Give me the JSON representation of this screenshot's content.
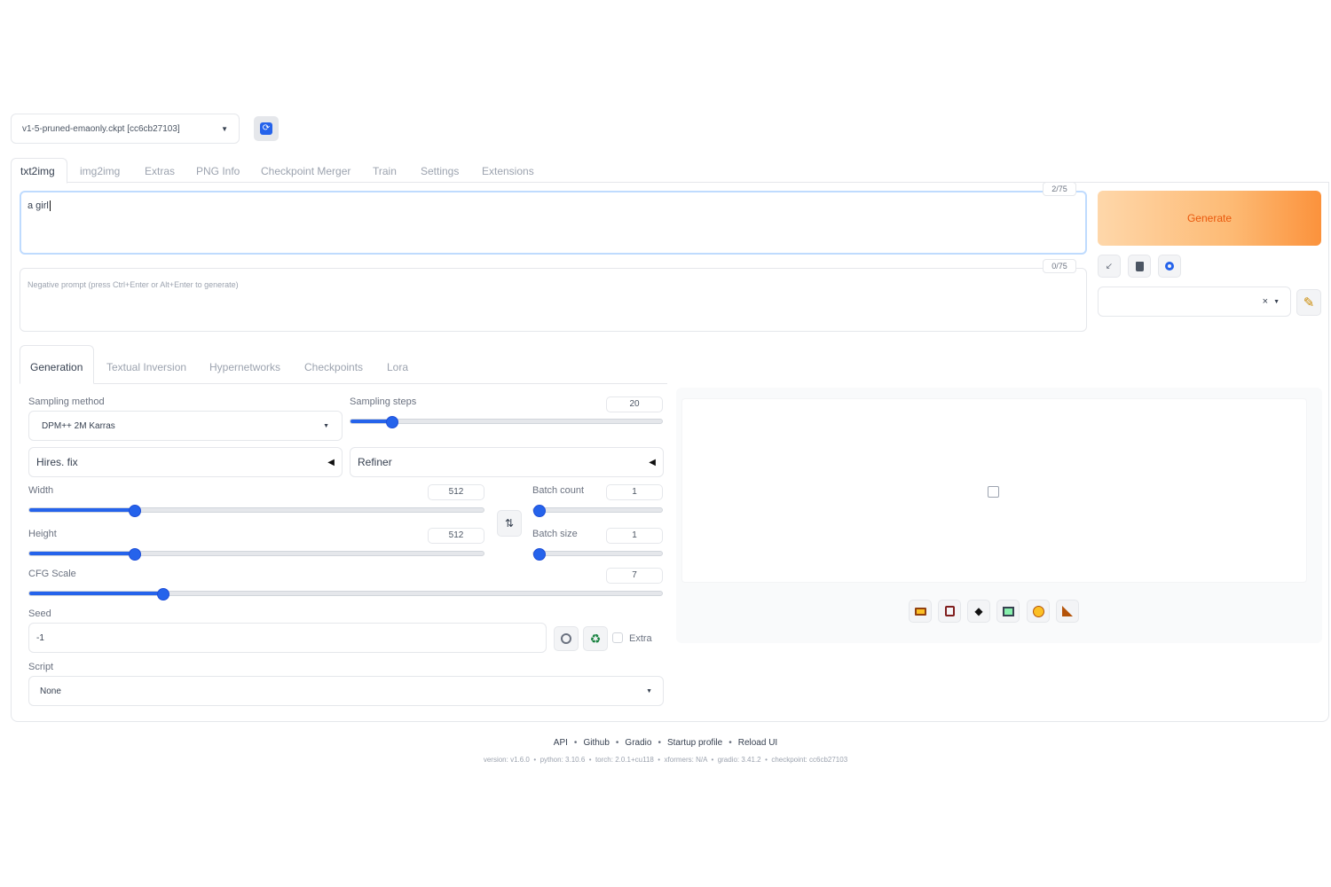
{
  "checkpoint": {
    "value": "v1-5-pruned-emaonly.ckpt [cc6cb27103]"
  },
  "tabs": [
    "txt2img",
    "img2img",
    "Extras",
    "PNG Info",
    "Checkpoint Merger",
    "Train",
    "Settings",
    "Extensions"
  ],
  "prompt": {
    "value": "a girl",
    "token_count": "2/75"
  },
  "negative_prompt": {
    "placeholder": "Negative prompt (press Ctrl+Enter or Alt+Enter to generate)",
    "token_count": "0/75"
  },
  "generate_button": {
    "label": "Generate"
  },
  "style_select": {
    "clear_icon": "×"
  },
  "gen_tabs": [
    "Generation",
    "Textual Inversion",
    "Hypernetworks",
    "Checkpoints",
    "Lora"
  ],
  "sampling_method": {
    "label": "Sampling method",
    "value": "DPM++ 2M Karras"
  },
  "sampling_steps": {
    "label": "Sampling steps",
    "value": "20",
    "fraction": 0.13
  },
  "hires_fix": {
    "label": "Hires. fix"
  },
  "refiner": {
    "label": "Refiner"
  },
  "width": {
    "label": "Width",
    "value": "512",
    "fraction": 0.23
  },
  "height": {
    "label": "Height",
    "value": "512",
    "fraction": 0.23
  },
  "batch_count": {
    "label": "Batch count",
    "value": "1",
    "fraction": 0.0
  },
  "batch_size": {
    "label": "Batch size",
    "value": "1",
    "fraction": 0.0
  },
  "cfg_scale": {
    "label": "CFG Scale",
    "value": "7",
    "fraction": 0.21
  },
  "seed": {
    "label": "Seed",
    "value": "-1",
    "extra_label": "Extra"
  },
  "script": {
    "label": "Script",
    "value": "None"
  },
  "footer": {
    "links": [
      "API",
      "Github",
      "Gradio",
      "Startup profile",
      "Reload UI"
    ],
    "version": "version: v1.6.0  •  python: 3.10.6  •  torch: 2.0.1+cu118  •  xformers: N/A  •  gradio: 3.41.2  •  checkpoint: cc6cb27103"
  },
  "colors": {
    "accent": "#2563eb",
    "generate_from": "#fdba74",
    "generate_to": "#fb923c",
    "generate_text": "#ea580c",
    "tab_active_border": "#e5e7eb"
  },
  "icons": [
    "refresh-icon",
    "pencil-check-icon",
    "trash-icon",
    "style-icon",
    "edit-icon",
    "swap-icon",
    "dice-icon",
    "recycle-icon",
    "image-placeholder-icon",
    "folder-icon",
    "save-icon",
    "zip-icon",
    "image-icon",
    "palette-icon",
    "ruler-icon"
  ]
}
